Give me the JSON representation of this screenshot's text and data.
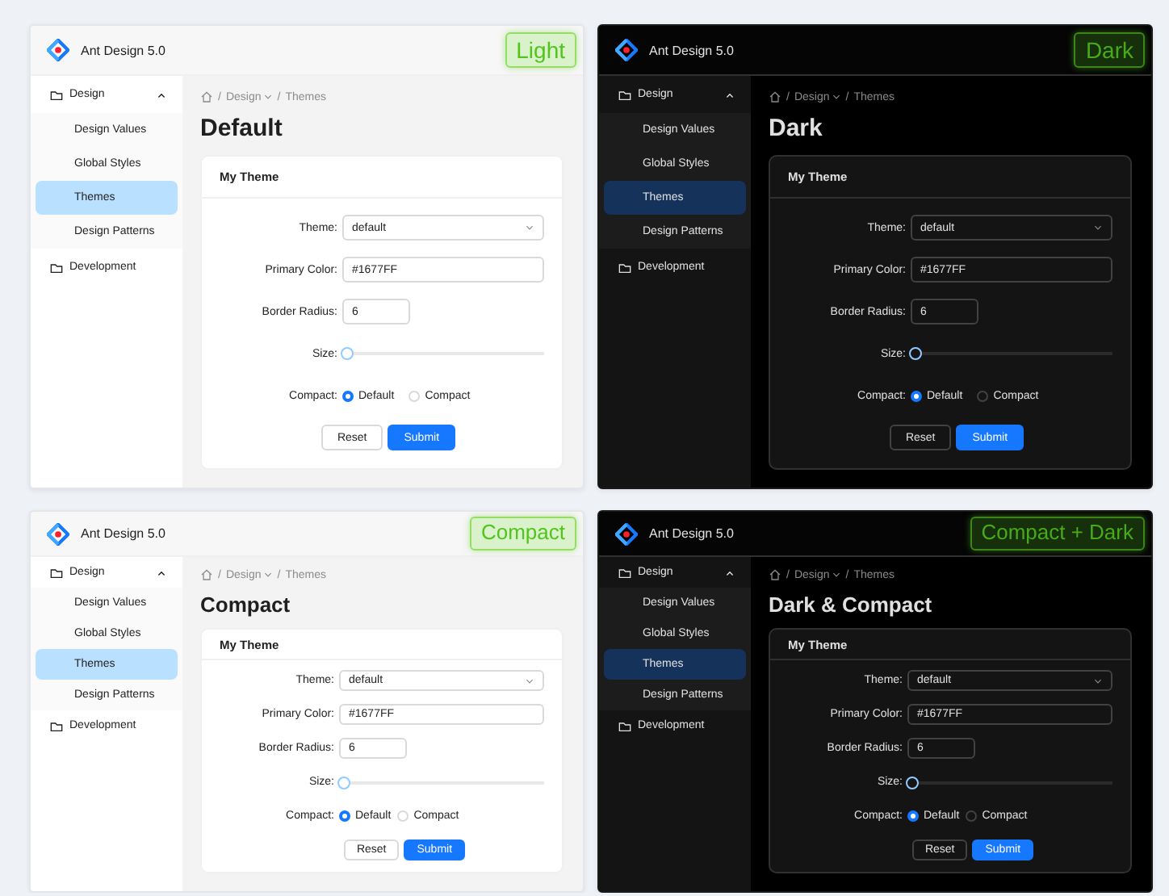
{
  "panels": [
    {
      "kind": "light",
      "compact": false,
      "app_title": "Ant Design 5.0",
      "badge": "Light",
      "menu": [
        {
          "label": "Design",
          "selected": false,
          "expanded": true,
          "children": [
            {
              "label": "Design Values",
              "selected": false
            },
            {
              "label": "Global Styles",
              "selected": false
            },
            {
              "label": "Themes",
              "selected": true
            },
            {
              "label": "Design Patterns",
              "selected": false
            }
          ]
        },
        {
          "label": "Development",
          "selected": false
        }
      ],
      "breadcrumb": [
        {
          "kind": "home"
        },
        {
          "kind": "separator",
          "text": "/"
        },
        {
          "kind": "link",
          "text": "Design",
          "dropdown": true
        },
        {
          "kind": "separator",
          "text": "/"
        },
        {
          "kind": "link",
          "text": "Themes",
          "dropdown": false
        }
      ],
      "heading": "Default",
      "card": {
        "title": "My Theme",
        "fields": [
          {
            "kind": "select",
            "label": "Theme:",
            "value": "default"
          },
          {
            "kind": "input",
            "label": "Primary Color:",
            "value": "#1677FF"
          },
          {
            "kind": "number",
            "label": "Border Radius:",
            "value": "6"
          },
          {
            "kind": "slider",
            "label": "Size:",
            "level": 0
          },
          {
            "kind": "radio",
            "label": "Compact:",
            "options": [
              {
                "label": "Default",
                "selected": true
              },
              {
                "label": "Compact",
                "selected": false
              }
            ]
          }
        ],
        "buttons": [
          {
            "label": "Reset",
            "primary": false
          },
          {
            "label": "Submit",
            "primary": true
          }
        ]
      }
    },
    {
      "kind": "dark",
      "compact": false,
      "app_title": "Ant Design 5.0",
      "badge": "Dark",
      "menu": [
        {
          "label": "Design",
          "selected": false,
          "expanded": true,
          "children": [
            {
              "label": "Design Values",
              "selected": false
            },
            {
              "label": "Global Styles",
              "selected": false
            },
            {
              "label": "Themes",
              "selected": true
            },
            {
              "label": "Design Patterns",
              "selected": false
            }
          ]
        },
        {
          "label": "Development",
          "selected": false
        }
      ],
      "breadcrumb": [
        {
          "kind": "home"
        },
        {
          "kind": "separator",
          "text": "/"
        },
        {
          "kind": "link",
          "text": "Design",
          "dropdown": true
        },
        {
          "kind": "separator",
          "text": "/"
        },
        {
          "kind": "link",
          "text": "Themes",
          "dropdown": false
        }
      ],
      "heading": "Dark",
      "card": {
        "title": "My Theme",
        "fields": [
          {
            "kind": "select",
            "label": "Theme:",
            "value": "default"
          },
          {
            "kind": "input",
            "label": "Primary Color:",
            "value": "#1677FF"
          },
          {
            "kind": "number",
            "label": "Border Radius:",
            "value": "6"
          },
          {
            "kind": "slider",
            "label": "Size:",
            "level": 0
          },
          {
            "kind": "radio",
            "label": "Compact:",
            "options": [
              {
                "label": "Default",
                "selected": true
              },
              {
                "label": "Compact",
                "selected": false
              }
            ]
          }
        ],
        "buttons": [
          {
            "label": "Reset",
            "primary": false
          },
          {
            "label": "Submit",
            "primary": true
          }
        ]
      }
    },
    {
      "kind": "light",
      "compact": true,
      "app_title": "Ant Design 5.0",
      "badge": "Compact",
      "menu": [
        {
          "label": "Design",
          "selected": false,
          "expanded": true,
          "children": [
            {
              "label": "Design Values",
              "selected": false
            },
            {
              "label": "Global Styles",
              "selected": false
            },
            {
              "label": "Themes",
              "selected": true
            },
            {
              "label": "Design Patterns",
              "selected": false
            }
          ]
        },
        {
          "label": "Development",
          "selected": false
        }
      ],
      "breadcrumb": [
        {
          "kind": "home"
        },
        {
          "kind": "separator",
          "text": "/"
        },
        {
          "kind": "link",
          "text": "Design",
          "dropdown": true
        },
        {
          "kind": "separator",
          "text": "/"
        },
        {
          "kind": "link",
          "text": "Themes",
          "dropdown": false
        }
      ],
      "heading": "Compact",
      "card": {
        "title": "My Theme",
        "fields": [
          {
            "kind": "select",
            "label": "Theme:",
            "value": "default"
          },
          {
            "kind": "input",
            "label": "Primary Color:",
            "value": "#1677FF"
          },
          {
            "kind": "number",
            "label": "Border Radius:",
            "value": "6"
          },
          {
            "kind": "slider",
            "label": "Size:",
            "level": 0
          },
          {
            "kind": "radio",
            "label": "Compact:",
            "options": [
              {
                "label": "Default",
                "selected": true
              },
              {
                "label": "Compact",
                "selected": false
              }
            ]
          }
        ],
        "buttons": [
          {
            "label": "Reset",
            "primary": false
          },
          {
            "label": "Submit",
            "primary": true
          }
        ]
      }
    },
    {
      "kind": "dark",
      "compact": true,
      "app_title": "Ant Design 5.0",
      "badge": "Compact + Dark",
      "menu": [
        {
          "label": "Design",
          "selected": false,
          "expanded": true,
          "children": [
            {
              "label": "Design Values",
              "selected": false
            },
            {
              "label": "Global Styles",
              "selected": false
            },
            {
              "label": "Themes",
              "selected": true
            },
            {
              "label": "Design Patterns",
              "selected": false
            }
          ]
        },
        {
          "label": "Development",
          "selected": false
        }
      ],
      "breadcrumb": [
        {
          "kind": "home"
        },
        {
          "kind": "separator",
          "text": "/"
        },
        {
          "kind": "link",
          "text": "Design",
          "dropdown": true
        },
        {
          "kind": "separator",
          "text": "/"
        },
        {
          "kind": "link",
          "text": "Themes",
          "dropdown": false
        }
      ],
      "heading": "Dark & Compact",
      "card": {
        "title": "My Theme",
        "fields": [
          {
            "kind": "select",
            "label": "Theme:",
            "value": "default"
          },
          {
            "kind": "input",
            "label": "Primary Color:",
            "value": "#1677FF"
          },
          {
            "kind": "number",
            "label": "Border Radius:",
            "value": "6"
          },
          {
            "kind": "slider",
            "label": "Size:",
            "level": 0
          },
          {
            "kind": "radio",
            "label": "Compact:",
            "options": [
              {
                "label": "Default",
                "selected": true
              },
              {
                "label": "Compact",
                "selected": false
              }
            ]
          }
        ],
        "buttons": [
          {
            "label": "Reset",
            "primary": false
          },
          {
            "label": "Submit",
            "primary": true
          }
        ]
      }
    }
  ]
}
